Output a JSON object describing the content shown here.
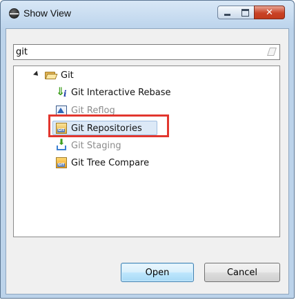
{
  "window": {
    "title": "Show View",
    "close_glyph": "✕"
  },
  "filter": {
    "value": "git",
    "placeholder": ""
  },
  "tree": {
    "category": "Git",
    "items": [
      {
        "label": "Git Interactive Rebase",
        "icon": "git-rebase-icon",
        "dimmed": false
      },
      {
        "label": "Git Reflog",
        "icon": "git-reflog-icon",
        "dimmed": true
      },
      {
        "label": "Git Repositories",
        "icon": "git-repositories-icon",
        "dimmed": false,
        "selected": true
      },
      {
        "label": "Git Staging",
        "icon": "git-staging-icon",
        "dimmed": true
      },
      {
        "label": "Git Tree Compare",
        "icon": "git-tree-compare-icon",
        "dimmed": false
      }
    ]
  },
  "buttons": {
    "open": "Open",
    "cancel": "Cancel"
  },
  "colors": {
    "highlight": "#e2362e",
    "selection": "#dce9f7",
    "close_button": "#c94326"
  }
}
